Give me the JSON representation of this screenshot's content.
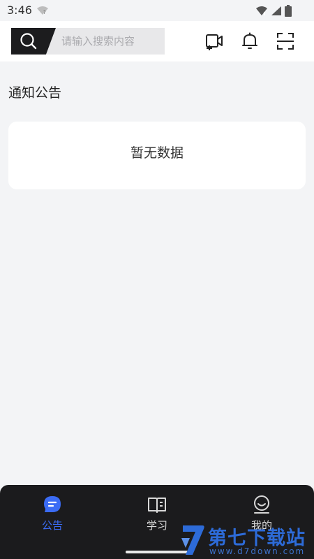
{
  "status_bar": {
    "time": "3:46",
    "icons": [
      "wifi-unknown-icon",
      "wifi-icon",
      "signal-icon",
      "battery-icon"
    ]
  },
  "header": {
    "search": {
      "placeholder": "请输入搜索内容",
      "value": "",
      "icon": "search-icon"
    },
    "actions": [
      "video-call-icon",
      "bell-icon",
      "scan-icon"
    ]
  },
  "main": {
    "section_title": "通知公告",
    "empty_text": "暂无数据"
  },
  "bottom_nav": {
    "items": [
      {
        "label": "公告",
        "icon": "announcement-icon",
        "active": true
      },
      {
        "label": "学习",
        "icon": "book-icon",
        "active": false
      },
      {
        "label": "我的",
        "icon": "profile-icon",
        "active": false
      }
    ]
  },
  "watermark": {
    "name": "第七下载站",
    "url": "www.d7down.com"
  },
  "colors": {
    "accent": "#3b6cf5",
    "nav_bg": "#1b1b1d",
    "page_bg": "#f3f4f6",
    "search_btn": "#1c1c1e",
    "watermark": "#2d6bd8"
  }
}
